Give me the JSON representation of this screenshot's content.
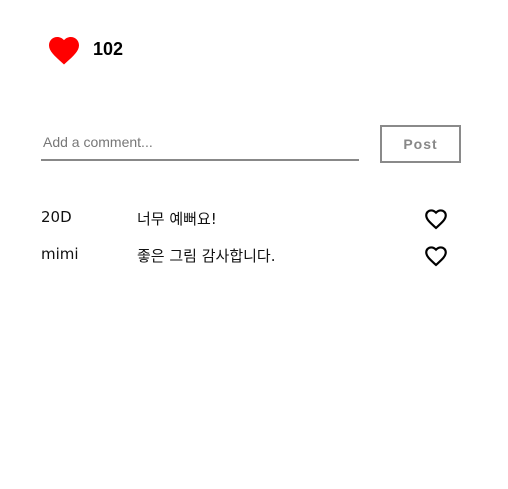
{
  "likes": {
    "count": "102",
    "icon": "heart-filled-icon",
    "color": "#ff0000"
  },
  "comment_form": {
    "placeholder": "Add a comment...",
    "value": "",
    "post_label": "Post"
  },
  "comments": [
    {
      "user": "20D",
      "text": "너무 예뻐요!",
      "liked": false,
      "icon": "heart-outline-icon"
    },
    {
      "user": "mimi",
      "text": "좋은 그림 감사합니다.",
      "liked": false,
      "icon": "heart-outline-icon"
    }
  ]
}
